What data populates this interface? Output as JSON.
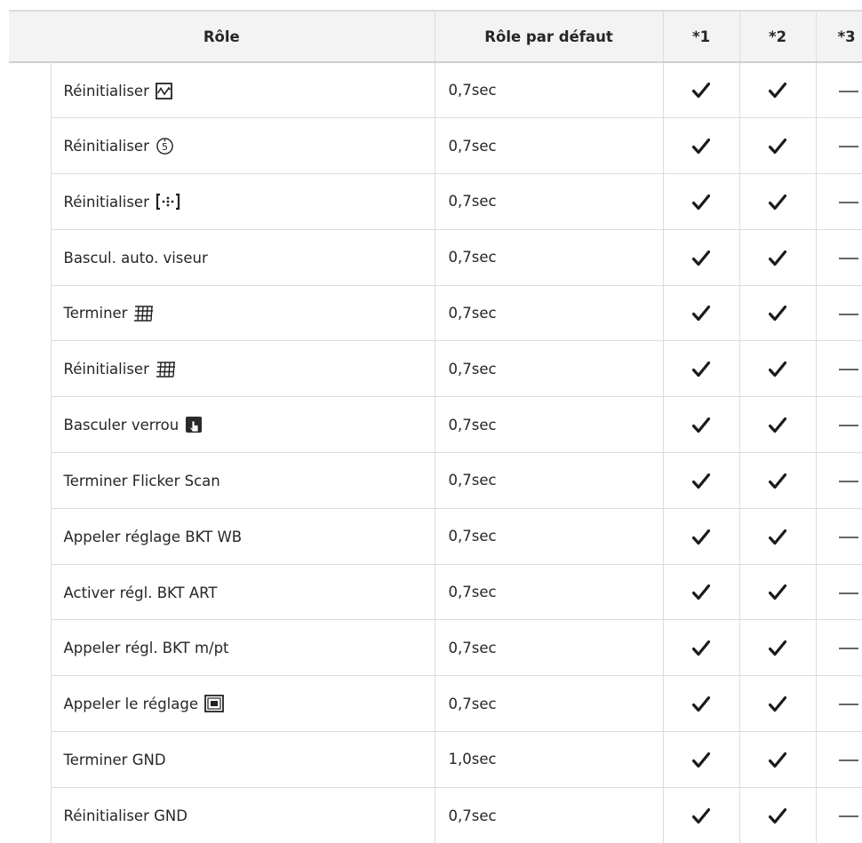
{
  "table": {
    "headers": {
      "role": "Rôle",
      "default_role": "Rôle par défaut",
      "col1": "*1",
      "col2": "*2",
      "col3": "*3"
    },
    "rows": [
      {
        "role": "Réinitialiser",
        "icon": "histogram-icon",
        "default": "0,7sec",
        "c1": "check",
        "c2": "check",
        "c3": "dash"
      },
      {
        "role": "Réinitialiser",
        "icon": "self-timer-icon",
        "default": "0,7sec",
        "c1": "check",
        "c2": "check",
        "c3": "dash"
      },
      {
        "role": "Réinitialiser",
        "icon": "af-target-icon",
        "default": "0,7sec",
        "c1": "check",
        "c2": "check",
        "c3": "dash"
      },
      {
        "role": "Bascul. auto. viseur",
        "icon": "",
        "default": "0,7sec",
        "c1": "check",
        "c2": "check",
        "c3": "dash"
      },
      {
        "role": "Terminer",
        "icon": "grid-icon",
        "default": "0,7sec",
        "c1": "check",
        "c2": "check",
        "c3": "dash"
      },
      {
        "role": "Réinitialiser",
        "icon": "grid-icon",
        "default": "0,7sec",
        "c1": "check",
        "c2": "check",
        "c3": "dash"
      },
      {
        "role": "Basculer verrou",
        "icon": "touch-lock-icon",
        "default": "0,7sec",
        "c1": "check",
        "c2": "check",
        "c3": "dash"
      },
      {
        "role": "Terminer Flicker Scan",
        "icon": "",
        "default": "0,7sec",
        "c1": "check",
        "c2": "check",
        "c3": "dash"
      },
      {
        "role": "Appeler réglage BKT WB",
        "icon": "",
        "default": "0,7sec",
        "c1": "check",
        "c2": "check",
        "c3": "dash"
      },
      {
        "role": "Activer régl. BKT ART",
        "icon": "",
        "default": "0,7sec",
        "c1": "check",
        "c2": "check",
        "c3": "dash"
      },
      {
        "role": "Appeler régl. BKT m/pt",
        "icon": "",
        "default": "0,7sec",
        "c1": "check",
        "c2": "check",
        "c3": "dash"
      },
      {
        "role": "Appeler le réglage",
        "icon": "multi-exposure-icon",
        "default": "0,7sec",
        "c1": "check",
        "c2": "check",
        "c3": "dash"
      },
      {
        "role": "Terminer GND",
        "icon": "",
        "default": "1,0sec",
        "c1": "check",
        "c2": "check",
        "c3": "dash"
      },
      {
        "role": "Réinitialiser GND",
        "icon": "",
        "default": "0,7sec",
        "c1": "check",
        "c2": "check",
        "c3": "dash"
      }
    ]
  }
}
